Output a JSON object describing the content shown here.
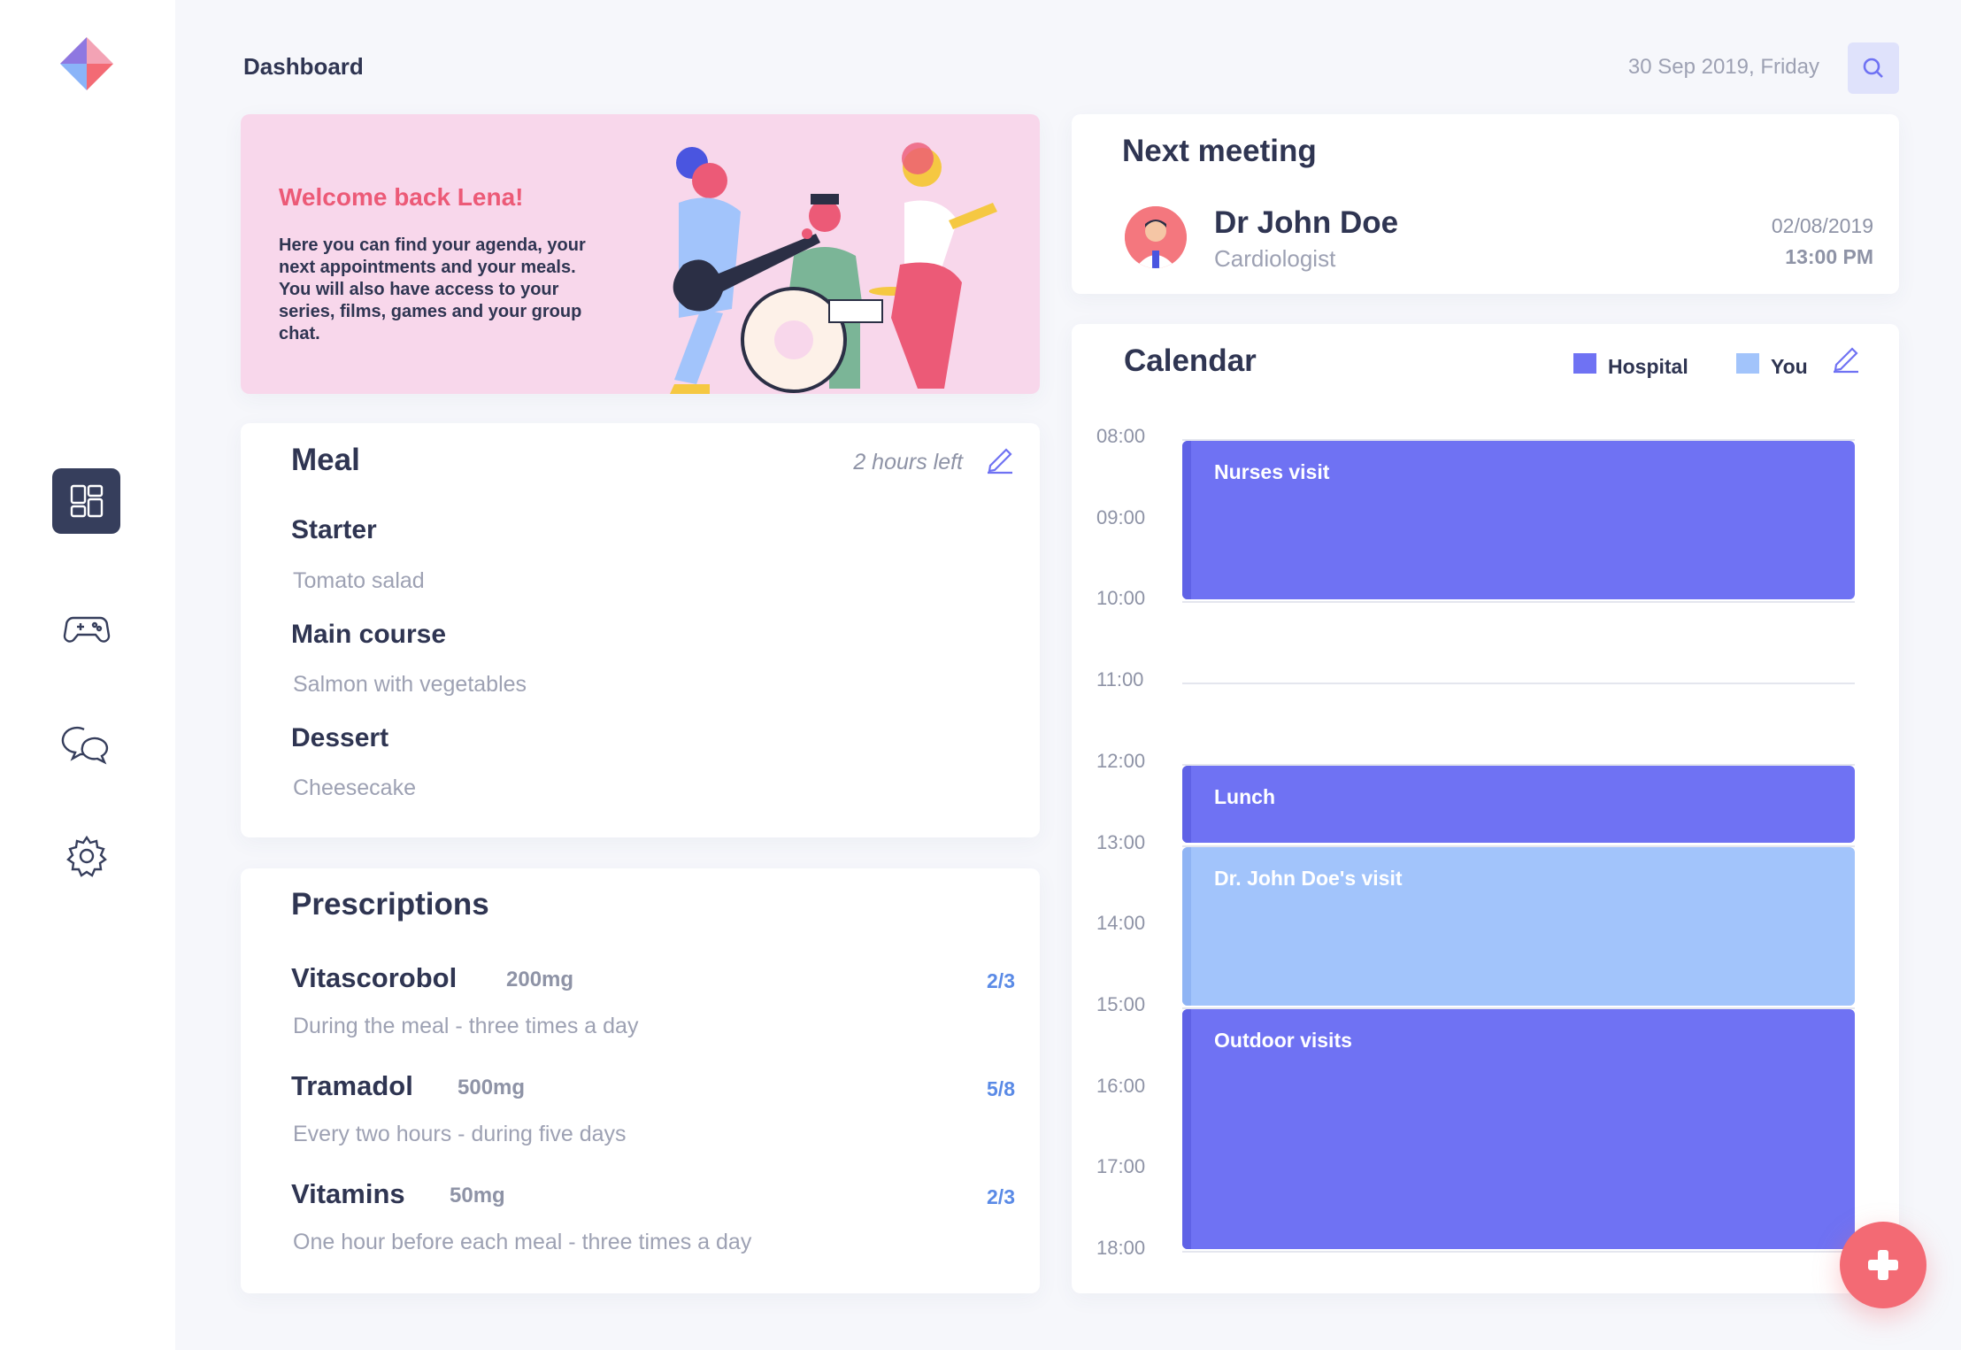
{
  "app": {
    "page_title": "Dashboard",
    "date": "30 Sep 2019, Friday"
  },
  "sidebar": {
    "items": [
      {
        "name": "dashboard",
        "icon": "dashboard-icon",
        "active": true
      },
      {
        "name": "games",
        "icon": "gamepad-icon",
        "active": false
      },
      {
        "name": "chat",
        "icon": "chat-icon",
        "active": false
      },
      {
        "name": "settings",
        "icon": "gear-icon",
        "active": false
      }
    ]
  },
  "welcome": {
    "title": "Welcome back Lena!",
    "text": "Here you can find your agenda, your next appointments and your meals. You will also have access to your series, films, games and your group chat."
  },
  "meal": {
    "title": "Meal",
    "time_left": "2 hours left",
    "courses": [
      {
        "label": "Starter",
        "value": "Tomato salad"
      },
      {
        "label": "Main course",
        "value": "Salmon with vegetables"
      },
      {
        "label": "Dessert",
        "value": "Cheesecake"
      }
    ]
  },
  "prescriptions": {
    "title": "Prescriptions",
    "items": [
      {
        "name": "Vitascorobol",
        "dose": "200mg",
        "count": "2/3",
        "desc": "During the meal - three times a day"
      },
      {
        "name": "Tramadol",
        "dose": "500mg",
        "count": "5/8",
        "desc": "Every two hours - during five days"
      },
      {
        "name": "Vitamins",
        "dose": "50mg",
        "count": "2/3",
        "desc": "One hour before each meal - three times a day"
      }
    ]
  },
  "meeting": {
    "title": "Next meeting",
    "doctor": "Dr John Doe",
    "role": "Cardiologist",
    "date": "02/08/2019",
    "time": "13:00 PM"
  },
  "calendar": {
    "title": "Calendar",
    "legend": [
      {
        "label": "Hospital",
        "color": "#6f72f3"
      },
      {
        "label": "You",
        "color": "#a2c4fb"
      }
    ],
    "hours": [
      "08:00",
      "09:00",
      "10:00",
      "11:00",
      "12:00",
      "13:00",
      "14:00",
      "15:00",
      "16:00",
      "17:00",
      "18:00"
    ],
    "events": [
      {
        "label": "Nurses visit",
        "start": "08:00",
        "end": "10:00",
        "owner": "Hospital"
      },
      {
        "label": "Lunch",
        "start": "12:00",
        "end": "13:00",
        "owner": "Hospital"
      },
      {
        "label": "Dr. John Doe's visit",
        "start": "13:00",
        "end": "15:00",
        "owner": "You"
      },
      {
        "label": "Outdoor visits",
        "start": "15:00",
        "end": "18:00",
        "owner": "Hospital"
      }
    ]
  },
  "colors": {
    "accent": "#6f72f3",
    "accent_light": "#a2c4fb",
    "pink": "#ec5a77",
    "fab": "#f36a74",
    "sidebar_active": "#363e5c"
  }
}
